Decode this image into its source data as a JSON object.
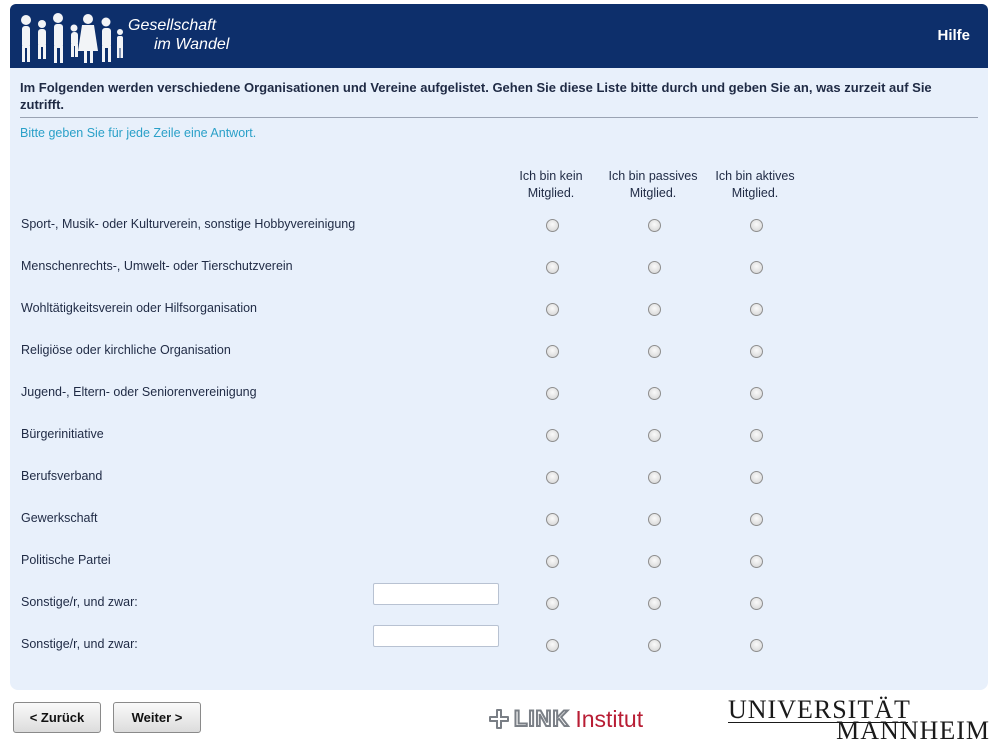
{
  "header": {
    "logo_line1": "Gesellschaft",
    "logo_line2": "im Wandel",
    "help_label": "Hilfe"
  },
  "survey": {
    "question": "Im Folgenden werden verschiedene Organisationen und Vereine aufgelistet. Gehen Sie diese Liste bitte durch und geben Sie an, was zurzeit auf Sie zutrifft.",
    "instruction": "Bitte geben Sie für jede Zeile eine Antwort.",
    "columns": [
      "Ich bin kein Mitglied.",
      "Ich bin passives Mitglied.",
      "Ich bin aktives Mitglied."
    ],
    "rows": [
      {
        "label": "Sport-, Musik- oder Kulturverein, sonstige Hobbyvereinigung"
      },
      {
        "label": "Menschenrechts-, Umwelt- oder Tierschutzverein"
      },
      {
        "label": "Wohltätigkeitsverein oder Hilfsorganisation"
      },
      {
        "label": "Religiöse oder kirchliche Organisation"
      },
      {
        "label": "Jugend-, Eltern- oder Seniorenvereinigung"
      },
      {
        "label": "Bürgerinitiative"
      },
      {
        "label": "Berufsverband"
      },
      {
        "label": "Gewerkschaft"
      },
      {
        "label": "Politische Partei"
      },
      {
        "label": "Sonstige/r, und zwar:",
        "text_value": ""
      },
      {
        "label": "Sonstige/r, und zwar:",
        "text_value": ""
      }
    ]
  },
  "nav": {
    "back_label": "< Zurück",
    "next_label": "Weiter >"
  },
  "footer": {
    "link_word": "LINK",
    "institut_word": "Institut",
    "university_line1": "UNIVERSITÄT",
    "university_line2": "MANNHEIM"
  },
  "colors": {
    "header_bg": "#0d2f6b",
    "panel_bg": "#e8f0fb",
    "instruction_text": "#2aa0c8",
    "link_institut_red": "#b81d34"
  }
}
